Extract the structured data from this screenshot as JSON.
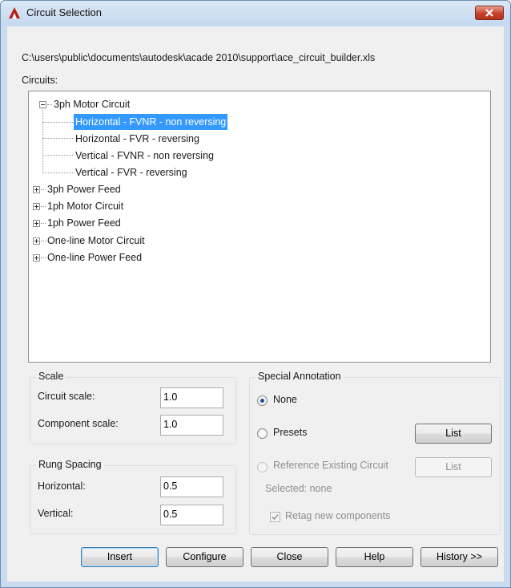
{
  "window": {
    "title": "Circuit Selection",
    "icon": "autocad-app-icon"
  },
  "path": "C:\\users\\public\\documents\\autodesk\\acade 2010\\support\\ace_circuit_builder.xls",
  "circuits_label": "Circuits:",
  "tree": {
    "items": [
      {
        "label": "3ph Motor Circuit",
        "level": 0,
        "expanded": true
      },
      {
        "label": "Horizontal - FVNR - non reversing",
        "level": 1,
        "selected": true
      },
      {
        "label": "Horizontal - FVR - reversing",
        "level": 1
      },
      {
        "label": "Vertical - FVNR - non reversing",
        "level": 1
      },
      {
        "label": "Vertical - FVR - reversing",
        "level": 1
      },
      {
        "label": "3ph Power Feed",
        "level": 0,
        "expanded": false
      },
      {
        "label": "1ph Motor Circuit",
        "level": 0,
        "expanded": false
      },
      {
        "label": "1ph Power Feed",
        "level": 0,
        "expanded": false
      },
      {
        "label": "One-line Motor Circuit",
        "level": 0,
        "expanded": false
      },
      {
        "label": "One-line Power Feed",
        "level": 0,
        "expanded": false
      }
    ]
  },
  "scale": {
    "title": "Scale",
    "circuit_scale_label": "Circuit scale:",
    "circuit_scale_value": "1.0",
    "component_scale_label": "Component scale:",
    "component_scale_value": "1.0"
  },
  "rung_spacing": {
    "title": "Rung Spacing",
    "horizontal_label": "Horizontal:",
    "horizontal_value": "0.5",
    "vertical_label": "Vertical:",
    "vertical_value": "0.5"
  },
  "special_annotation": {
    "title": "Special Annotation",
    "none_label": "None",
    "presets_label": "Presets",
    "reference_label": "Reference Existing Circuit",
    "list_label": "List",
    "list2_label": "List",
    "selected_text": "Selected: none",
    "retag_label": "Retag new components",
    "selected_option": "None"
  },
  "buttons": {
    "insert": "Insert",
    "configure": "Configure",
    "close": "Close",
    "help": "Help",
    "history": "History >>"
  }
}
